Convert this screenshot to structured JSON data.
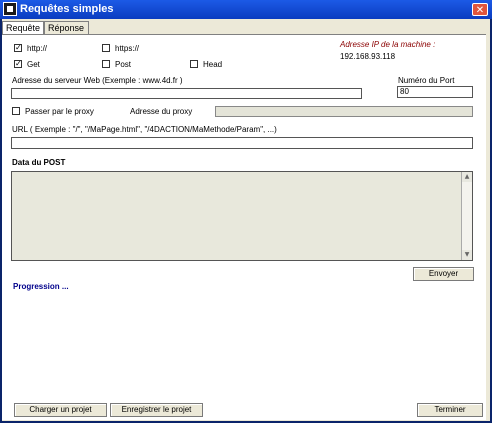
{
  "window": {
    "title": "Requêtes simples",
    "close_glyph": "✕"
  },
  "tabs": [
    {
      "label": "Requête"
    },
    {
      "label": "Réponse"
    }
  ],
  "protocol": {
    "http_label": "http://",
    "http_checked": true,
    "https_label": "https://",
    "https_checked": false
  },
  "method": {
    "get_label": "Get",
    "get_checked": true,
    "post_label": "Post",
    "post_checked": false,
    "head_label": "Head",
    "head_checked": false
  },
  "ip": {
    "label": "Adresse IP de la machine :",
    "value": "192.168.93.118",
    "color": "#8b0000"
  },
  "server": {
    "label": "Adresse du serveur Web (Exemple : www.4d.fr )",
    "value": ""
  },
  "port": {
    "label": "Numéro du Port",
    "value": "80"
  },
  "proxy": {
    "checkbox_label": "Passer par le proxy",
    "checked": false,
    "address_label": "Adresse du proxy",
    "address_value": ""
  },
  "url": {
    "label": "URL ( Exemple : \"/\", \"/MaPage.html\", \"/4DACTION/MaMethode/Param\", ...)",
    "value": ""
  },
  "post": {
    "label": "Data du POST",
    "value": "",
    "scroll_up": "▲",
    "scroll_down": "▼"
  },
  "send_button": "Envoyer",
  "progress": {
    "label": "Progression ...",
    "color": "#00008b"
  },
  "footer": {
    "load_button": "Charger un projet",
    "save_button": "Enregistrer le projet",
    "quit_button": "Terminer"
  }
}
